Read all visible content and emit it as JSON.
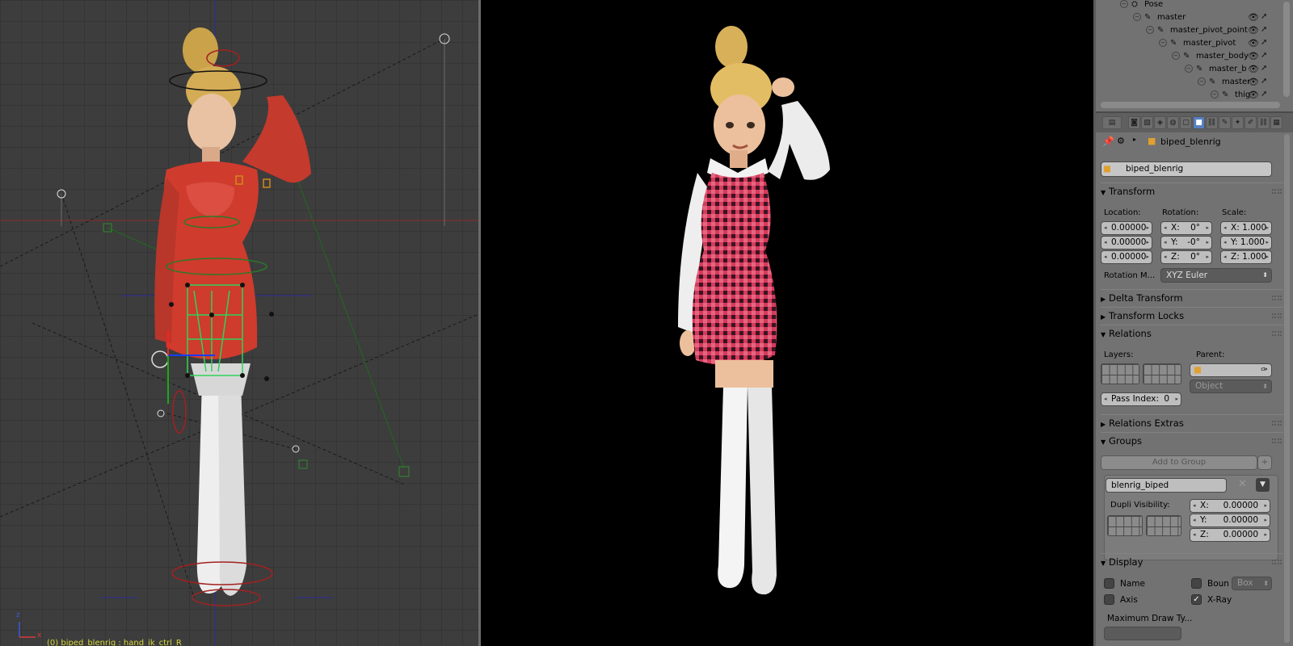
{
  "viewport": {
    "status_text": "(0) biped_blenrig : hand_ik_ctrl_R",
    "axis_x": "x",
    "axis_z": "z"
  },
  "outliner": {
    "rows": [
      {
        "label": "Pose"
      },
      {
        "label": "master"
      },
      {
        "label": "master_pivot_point"
      },
      {
        "label": "master_pivot"
      },
      {
        "label": "master_body"
      },
      {
        "label": "master_bod"
      },
      {
        "label": "master"
      },
      {
        "label": "thig"
      }
    ]
  },
  "header": {
    "object_name": "biped_blenrig",
    "datablock_name": "biped_blenrig"
  },
  "transform": {
    "title": "Transform",
    "location_label": "Location:",
    "rotation_label": "Rotation:",
    "scale_label": "Scale:",
    "location": [
      "0.00000",
      "0.00000",
      "0.00000"
    ],
    "rotation": [
      {
        "axis": "X:",
        "value": "0°"
      },
      {
        "axis": "Y:",
        "value": "-0°"
      },
      {
        "axis": "Z:",
        "value": "0°"
      }
    ],
    "scale": [
      "X: 1.000",
      "Y: 1.000",
      "Z: 1.000"
    ],
    "rotation_mode_label": "Rotation M...",
    "rotation_mode_value": "XYZ Euler"
  },
  "panels": {
    "delta": "Delta Transform",
    "locks": "Transform Locks",
    "relations": "Relations",
    "relations_extras": "Relations Extras",
    "groups": "Groups",
    "display": "Display"
  },
  "relations": {
    "layers_label": "Layers:",
    "parent_label": "Parent:",
    "parent_type": "Object",
    "pass_index_label": "Pass Index:",
    "pass_index_value": "0"
  },
  "groups": {
    "add_label": "Add to Group",
    "group_name": "blenrig_biped",
    "dupli_label": "Dupli Visibility:",
    "dupli": [
      {
        "axis": "X:",
        "value": "0.00000"
      },
      {
        "axis": "Y:",
        "value": "0.00000"
      },
      {
        "axis": "Z:",
        "value": "0.00000"
      }
    ]
  },
  "display": {
    "name_label": "Name",
    "bounds_label": "Boun",
    "bounds_type": "Box",
    "axis_label": "Axis",
    "xray_label": "X-Ray",
    "xray_checked": "✓",
    "max_draw_label": "Maximum Draw Ty..."
  },
  "colors": {
    "panel_bg": "#727272",
    "viewport_bg": "#3d3d3d",
    "accent": "#5680c2"
  }
}
